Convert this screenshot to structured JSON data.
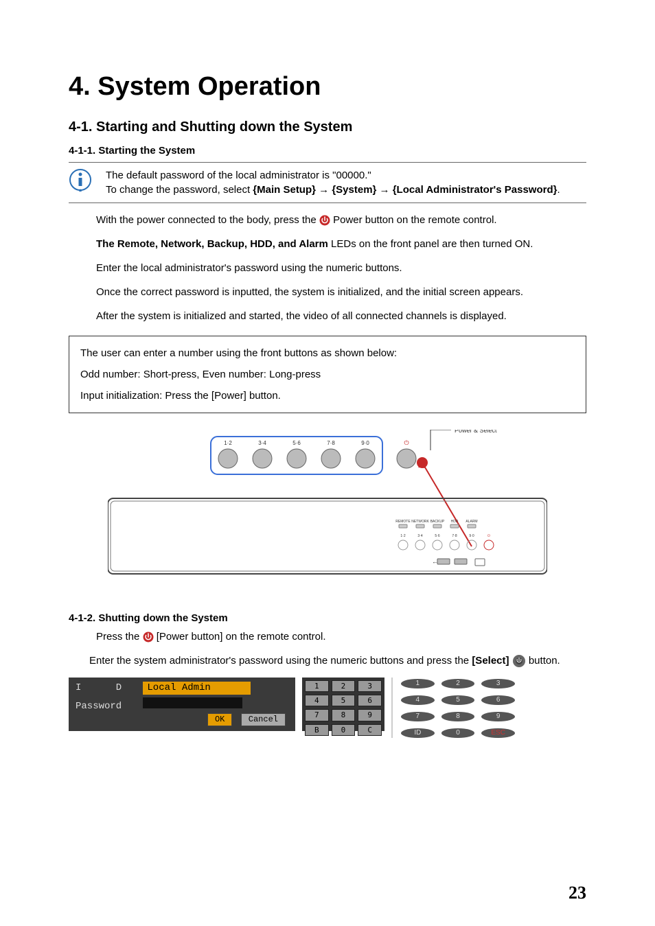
{
  "headings": {
    "chapter": "4. System Operation",
    "section_4_1": "4-1. Starting and Shutting down the System",
    "section_4_1_1": "4-1-1. Starting the System",
    "section_4_1_2": "4-1-2. Shutting down the System"
  },
  "info_box": {
    "line1": "The default password of the local administrator is \"00000.\"",
    "line2_prefix": " To change the password, select ",
    "path1": "{Main Setup}",
    "arrow": " → ",
    "path2": "{System}",
    "path3": "{Local Administrator's Password}",
    "period": "."
  },
  "para1_a": "With the power connected to the body, press the ",
  "para1_b": " Power button on the remote control.",
  "para2_a": "The Remote, Network, Backup, HDD, and Alarm",
  "para2_b": " LEDs on the front panel are then turned ON.",
  "para3": "Enter the local administrator's password using the numeric buttons.",
  "para4": "Once the correct password is inputted, the system is initialized, and the initial screen appears.",
  "para5": "After the system is initialized and started, the video of all connected channels is displayed.",
  "note": {
    "l1": "The user can enter a number using the front buttons as shown below:",
    "l2": " Odd number: Short-press, Even number: Long-press",
    "l3": " Input initialization: Press the [Power] button."
  },
  "diagram": {
    "btn_labels": [
      "1·2",
      "3·4",
      "5·6",
      "7·8",
      "9·0"
    ],
    "power_select_label": "Power & Select",
    "led_labels": [
      "REMOTE",
      "NETWORK",
      "BACKUP",
      "HDD",
      "ALARM"
    ],
    "small_labels": [
      "1·2",
      "3·4",
      "5·6",
      "7·8",
      "9·0"
    ]
  },
  "shutdown": {
    "p1_a": "Press the ",
    "p1_b": " [Power button] on the remote control.",
    "p2_a": "Enter the system administrator's password using the numeric buttons and press the ",
    "p2_b": "[Select]",
    "p2_c": " button."
  },
  "login": {
    "id_label": "I      D",
    "id_value": "Local Admin",
    "pwd_label": "Password",
    "ok": "OK",
    "cancel": "Cancel"
  },
  "keypad": [
    "1",
    "2",
    "3",
    "4",
    "5",
    "6",
    "7",
    "8",
    "9",
    "B",
    "0",
    "C"
  ],
  "remote_keypad": [
    "1",
    "2",
    "3",
    "4",
    "5",
    "6",
    "7",
    "8",
    "9",
    "ID",
    "0",
    "ESC"
  ],
  "page_number": "23"
}
